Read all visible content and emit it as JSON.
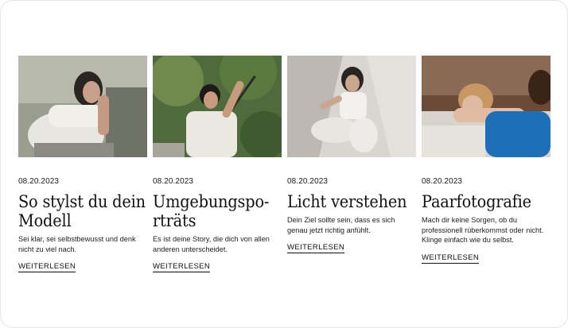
{
  "cards": [
    {
      "date": "08.20.2023",
      "title": "So stylst du dein Modell",
      "description": "Sei klar, sei selbstbewusst und denk nicht zu viel nach.",
      "link": "WEITERLESEN"
    },
    {
      "date": "08.20.2023",
      "title": "Umgebungspo-rträts",
      "description": "Es ist deine Story, die dich von allen anderen unterscheidet.",
      "link": "WEITERLESEN"
    },
    {
      "date": "08.20.2023",
      "title": "Licht verstehen",
      "description": "Dein Ziel sollte sein, dass es sich genau jetzt richtig anfühlt.",
      "link": "WEITERLESEN"
    },
    {
      "date": "08.20.2023",
      "title": "Paarfotografie",
      "description": "Mach dir keine Sorgen, ob du professionell rüberkommst oder nicht. Klinge einfach wie du selbst.",
      "link": "WEITERLESEN"
    }
  ]
}
